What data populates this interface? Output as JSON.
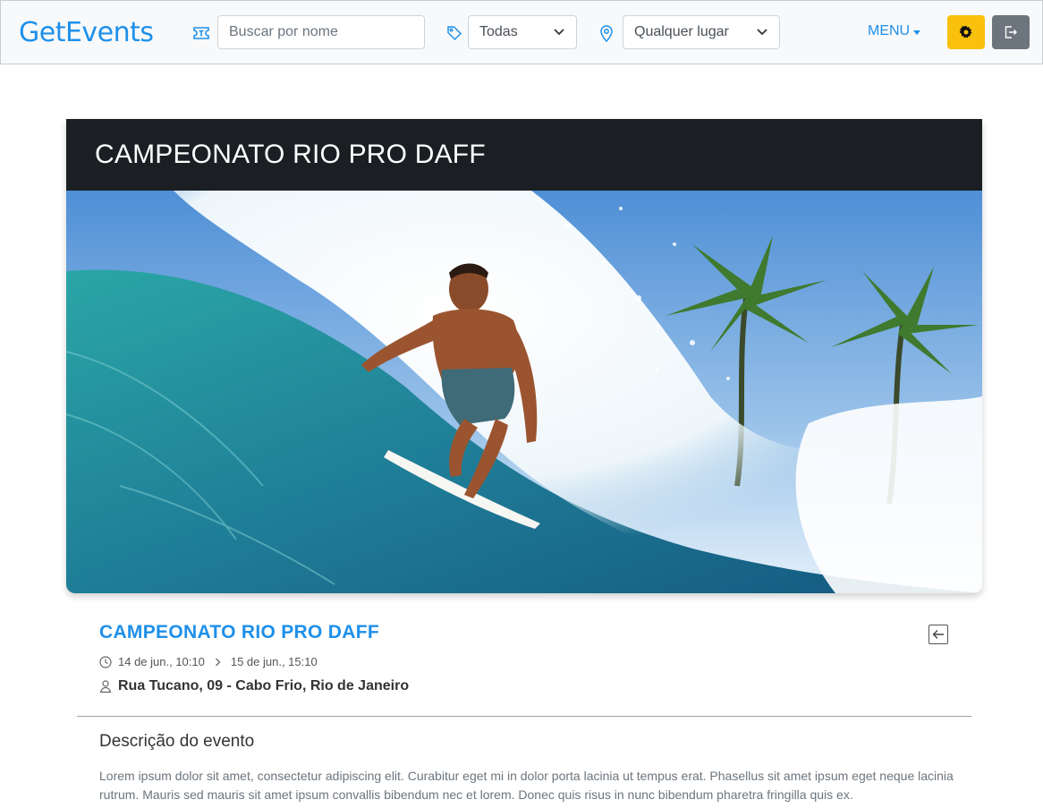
{
  "navbar": {
    "brand": "GetEvents",
    "search": {
      "placeholder": "Buscar por nome",
      "value": ""
    },
    "category_select": {
      "value": "Todas"
    },
    "location_select": {
      "value": "Qualquer lugar"
    },
    "menu_label": "MENU",
    "colors": {
      "brand": "#1e90ea",
      "settings_button": "#f9c10b",
      "logout_button": "#6c757d"
    }
  },
  "hero": {
    "title": "CAMPEONATO RIO PRO DAFF",
    "image_icon": "surfer-wave-photo"
  },
  "event": {
    "title": "CAMPEONATO RIO PRO DAFF",
    "start": "14 de jun., 10:10",
    "end": "15 de jun., 15:10",
    "address": "Rua Tucano, 09 - Cabo Frio, Rio de Janeiro"
  },
  "description": {
    "heading": "Descrição do evento",
    "text": "Lorem ipsum dolor sit amet, consectetur adipiscing elit. Curabitur eget mi in dolor porta lacinia ut tempus erat. Phasellus sit amet ipsum eget neque lacinia rutrum. Mauris sed mauris sit amet ipsum convallis bibendum nec et lorem. Donec quis risus in nunc bibendum pharetra fringilla quis ex."
  }
}
